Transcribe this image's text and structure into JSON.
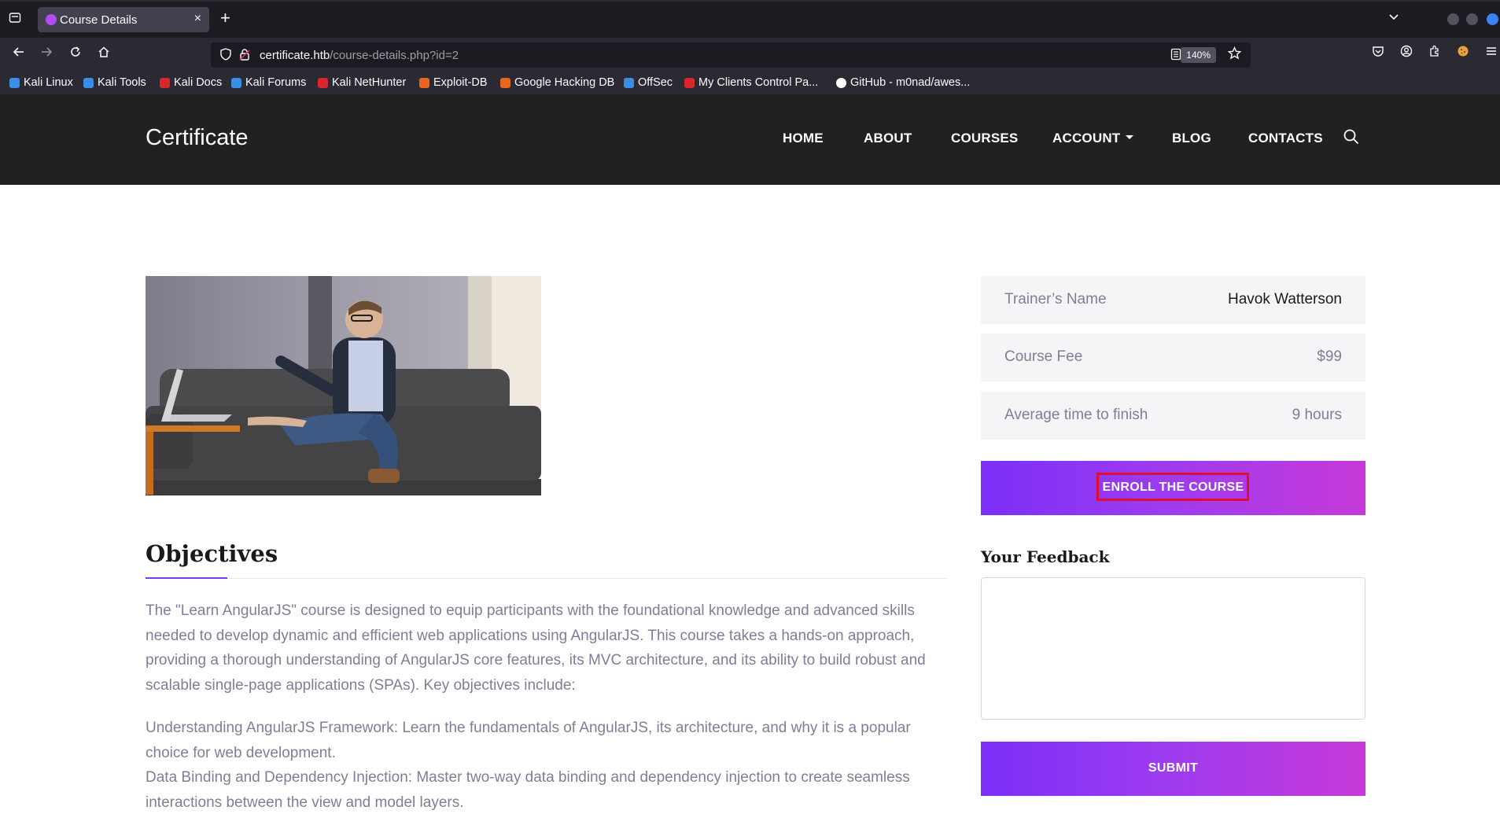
{
  "browser": {
    "tab_title": "Course Details",
    "tab_close": "×",
    "new_tab": "+",
    "url_host": "certificate.htb",
    "url_path": "/course-details.php?id=2",
    "zoom": "140%",
    "bookmarks": [
      {
        "label": "Kali Linux",
        "color": "#3a8ee6"
      },
      {
        "label": "Kali Tools",
        "color": "#3a8ee6"
      },
      {
        "label": "Kali Docs",
        "color": "#d9262e"
      },
      {
        "label": "Kali Forums",
        "color": "#3a8ee6"
      },
      {
        "label": "Kali NetHunter",
        "color": "#d9262e"
      },
      {
        "label": "Exploit-DB",
        "color": "#e8671c"
      },
      {
        "label": "Google Hacking DB",
        "color": "#e8671c"
      },
      {
        "label": "OffSec",
        "color": "#3a8ee6"
      },
      {
        "label": "My Clients Control Pa...",
        "color": "#d9262e"
      },
      {
        "label": "GitHub - m0nad/awes...",
        "color": "#ffffff"
      }
    ]
  },
  "site": {
    "brand": "Certificate",
    "menu": [
      "HOME",
      "ABOUT",
      "COURSES",
      "ACCOUNT",
      "BLOG",
      "CONTACTS"
    ]
  },
  "course": {
    "info": [
      {
        "key": "Trainer’s Name",
        "value": "Havok Watterson"
      },
      {
        "key": "Course Fee",
        "value": "$99"
      },
      {
        "key": "Average time to finish",
        "value": "9 hours"
      }
    ],
    "enroll_label": "ENROLL THE COURSE",
    "feedback_title": "Your Feedback",
    "submit_label": "SUBMIT",
    "objectives_title": "Objectives",
    "paragraph_1": "The \"Learn AngularJS\" course is designed to equip participants with the foundational knowledge and advanced skills needed to develop dynamic and efficient web applications using AngularJS. This course takes a hands-on approach, providing a thorough understanding of AngularJS core features, its MVC architecture, and its ability to build robust and scalable single-page applications (SPAs). Key objectives include:",
    "paragraph_2": "Understanding AngularJS Framework: Learn the fundamentals of AngularJS, its architecture, and why it is a popular choice for web development.",
    "paragraph_3": "Data Binding and Dependency Injection: Master two-way data binding and dependency injection to create seamless interactions between the view and model layers."
  },
  "colors": {
    "accent": "#7b2ff7",
    "accent_end": "#c73ad9",
    "highlight_outline": "#e0102c"
  }
}
